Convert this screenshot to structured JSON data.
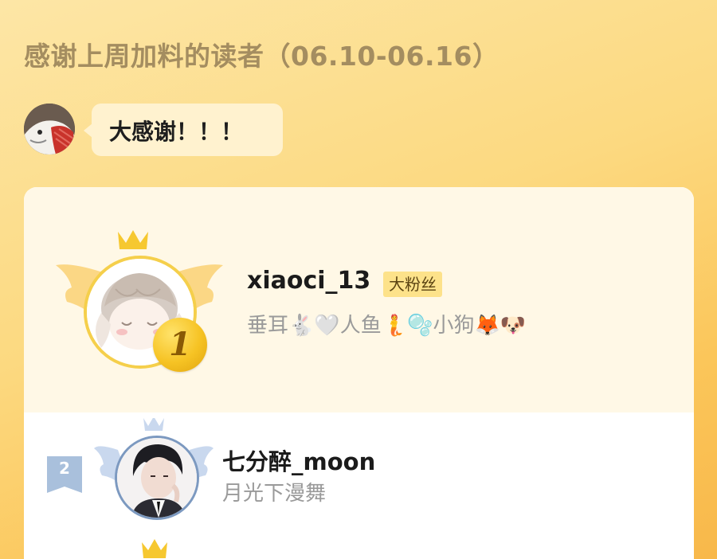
{
  "header": {
    "title": "感谢上周加料的读者（06.10-06.16）"
  },
  "author": {
    "message": "大感谢！！！"
  },
  "leaderboard": {
    "first": {
      "rank": "1",
      "name": "xiaoci_13",
      "badge": "大粉丝",
      "motto_parts": [
        "垂耳",
        "🐇",
        "🤍",
        "人鱼",
        "🧜",
        "🫧",
        "小狗",
        "🦊",
        "🐶"
      ]
    },
    "second": {
      "rank": "2",
      "name": "七分醉_moon",
      "motto": "月光下漫舞"
    }
  },
  "colors": {
    "title": "#a48d60",
    "card_top": "#fff8e6",
    "gold": "#f5cf4b",
    "silver_blue": "#7c99c0",
    "fan_badge": "#fde28a"
  }
}
